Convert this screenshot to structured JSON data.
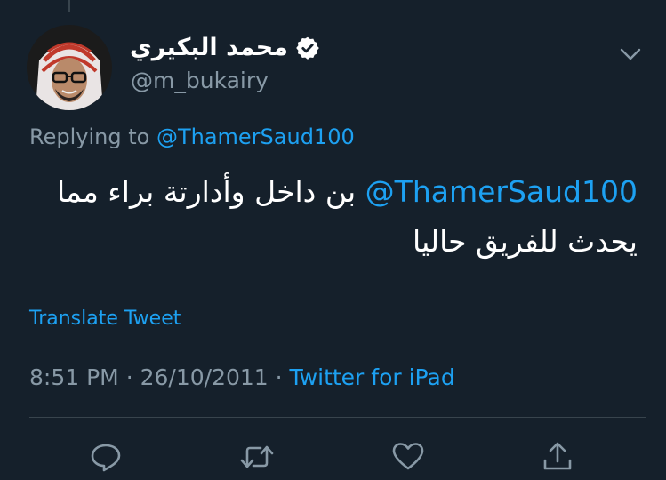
{
  "tweet": {
    "author_name": "محمد البكيري",
    "author_handle": "@m_bukairy",
    "verified": true,
    "replying_label": "Replying to",
    "replying_to": "@ThamerSaud100",
    "text_mention": "@ThamerSaud100",
    "text_body": "بن داخل وأدارتة براء مما يحدث للفريق حاليا",
    "translate_label": "Translate Tweet",
    "time": "8:51 PM",
    "date": "26/10/2011",
    "separator": "·",
    "source": "Twitter for iPad"
  },
  "icons": {
    "verified": "verified-badge-icon",
    "more": "chevron-down-icon",
    "reply": "reply-icon",
    "retweet": "retweet-icon",
    "like": "heart-icon",
    "share": "share-icon"
  },
  "colors": {
    "background": "#15202b",
    "accent": "#1da1f2",
    "secondary_text": "#8899a6",
    "divider": "#38444d",
    "primary_text": "#ffffff"
  }
}
